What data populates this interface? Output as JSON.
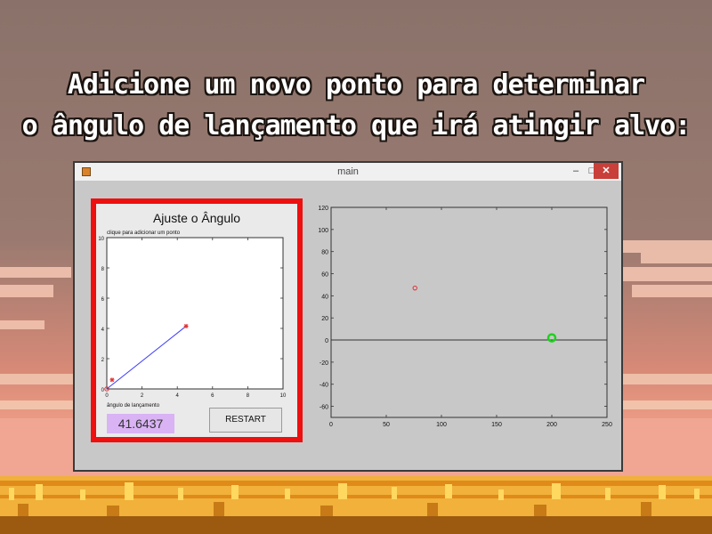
{
  "headline": {
    "line1": "Adicione um novo ponto para determinar",
    "line2": "o ângulo de lançamento que irá atingir alvo:"
  },
  "window": {
    "title": "main",
    "controls": {
      "minimize": "–",
      "maximize": "□",
      "close": "✕"
    }
  },
  "panel": {
    "title": "Ajuste o Ângulo",
    "hint": "clique para adicionar um ponto",
    "xlabel": "ângulo de lançamento",
    "angle_value": "41.6437",
    "restart_label": "RESTART"
  },
  "chart_data": [
    {
      "type": "line",
      "title": "",
      "xlabel": "ângulo de lançamento",
      "ylabel": "",
      "xlim": [
        0,
        10
      ],
      "ylim": [
        0,
        10
      ],
      "xticks": [
        "0",
        "2",
        "4",
        "6",
        "8",
        "10"
      ],
      "yticks": [
        "0",
        "2",
        "4",
        "6",
        "8",
        "10"
      ],
      "grid": false,
      "series": [
        {
          "color": "#3b3bff",
          "points": [
            [
              0,
              0
            ],
            [
              4.5,
              4.15
            ]
          ]
        },
        {
          "color": "#e03030",
          "marker": "star",
          "points": [
            [
              0.3,
              0.6
            ],
            [
              4.5,
              4.15
            ]
          ]
        },
        {
          "color": "#e03030",
          "marker": "circle",
          "points": [
            [
              0,
              0
            ]
          ]
        }
      ]
    },
    {
      "type": "scatter",
      "title": "",
      "xlabel": "",
      "ylabel": "",
      "xlim": [
        0,
        250
      ],
      "ylim": [
        -70,
        120
      ],
      "xticks": [
        "0",
        "50",
        "100",
        "150",
        "200",
        "250"
      ],
      "yticks": [
        "-60",
        "-40",
        "-20",
        "0",
        "20",
        "40",
        "60",
        "80",
        "100",
        "120"
      ],
      "grid": false,
      "series": [
        {
          "color": "#e03030",
          "marker": "circle",
          "points": [
            [
              76,
              47
            ]
          ]
        },
        {
          "color": "#1fd11f",
          "marker": "target",
          "points": [
            [
              200,
              2
            ]
          ]
        }
      ],
      "hline": {
        "y": 0,
        "color": "#333333"
      }
    }
  ]
}
